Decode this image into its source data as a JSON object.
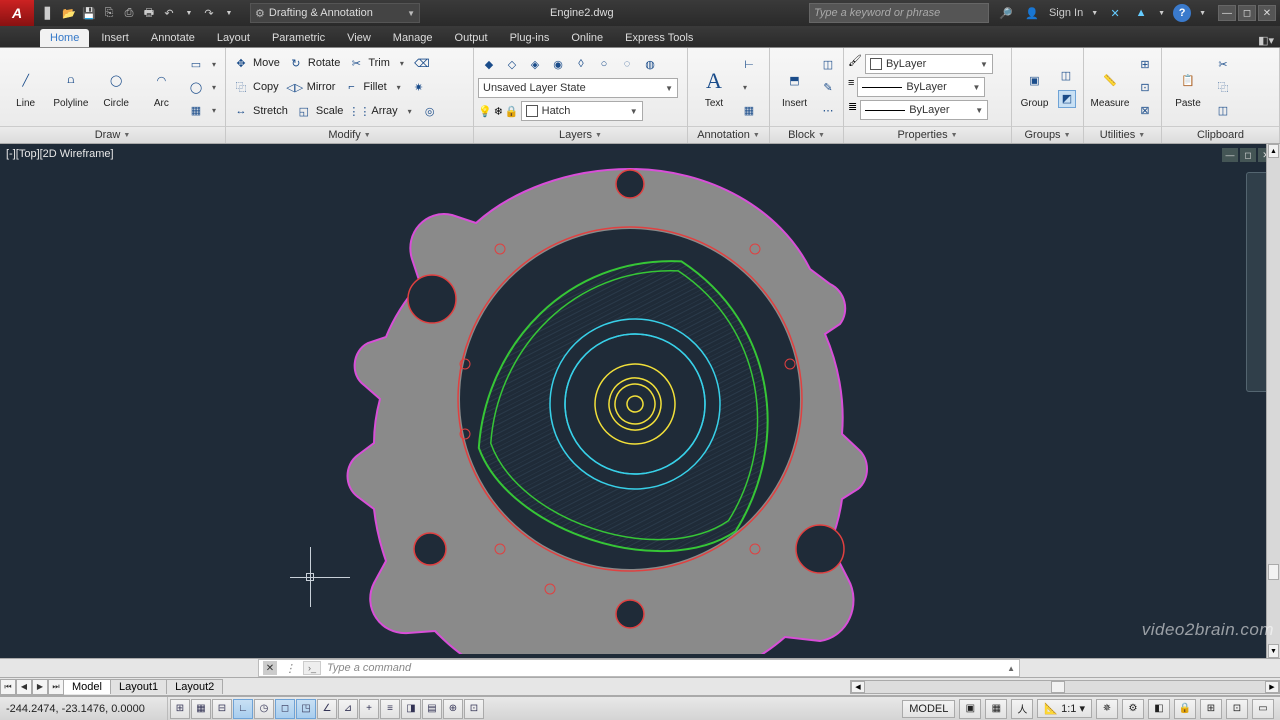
{
  "app": {
    "document": "Engine2.dwg",
    "workspace": "Drafting & Annotation",
    "search_placeholder": "Type a keyword or phrase",
    "signin": "Sign In"
  },
  "tabs": [
    "Home",
    "Insert",
    "Annotate",
    "Layout",
    "Parametric",
    "View",
    "Manage",
    "Output",
    "Plug-ins",
    "Online",
    "Express Tools"
  ],
  "active_tab": "Home",
  "ribbon": {
    "draw": {
      "title": "Draw",
      "line": "Line",
      "polyline": "Polyline",
      "circle": "Circle",
      "arc": "Arc"
    },
    "modify": {
      "title": "Modify",
      "move": "Move",
      "rotate": "Rotate",
      "trim": "Trim",
      "copy": "Copy",
      "mirror": "Mirror",
      "fillet": "Fillet",
      "stretch": "Stretch",
      "scale": "Scale",
      "array": "Array"
    },
    "layers": {
      "title": "Layers",
      "state": "Unsaved Layer State",
      "hatch": "Hatch"
    },
    "annotation": {
      "title": "Annotation",
      "text": "Text"
    },
    "block": {
      "title": "Block",
      "insert": "Insert"
    },
    "properties": {
      "title": "Properties",
      "color": "ByLayer",
      "line1": "ByLayer",
      "line2": "ByLayer"
    },
    "groups": {
      "title": "Groups",
      "group": "Group"
    },
    "utilities": {
      "title": "Utilities",
      "measure": "Measure"
    },
    "clipboard": {
      "title": "Clipboard",
      "paste": "Paste"
    }
  },
  "view": {
    "label": "[-][Top][2D Wireframe]"
  },
  "cmd": {
    "placeholder": "Type a command"
  },
  "model_tabs": [
    "Model",
    "Layout1",
    "Layout2"
  ],
  "status": {
    "coords": "-244.2474, -23.1476, 0.0000",
    "space": "MODEL",
    "scale": "1:1"
  },
  "watermark": "video2brain.com"
}
